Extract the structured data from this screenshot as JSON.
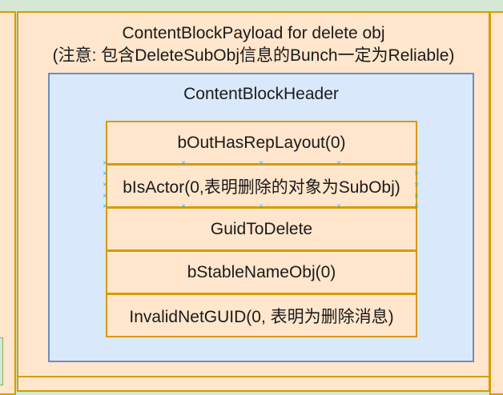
{
  "payload": {
    "title_line1": "ContentBlockPayload for delete obj",
    "title_line2": "(注意: 包含DeleteSubObj信息的Bunch一定为Reliable)"
  },
  "header": {
    "title": "ContentBlockHeader"
  },
  "fields": [
    {
      "label": "bOutHasRepLayout(0)"
    },
    {
      "label": "bIsActor(0,表明删除的对象为SubObj)"
    },
    {
      "label": "GuidToDelete"
    },
    {
      "label": "bStableNameObj(0)"
    },
    {
      "label": "InvalidNetGUID(0, 表明为删除消息)"
    }
  ],
  "colors": {
    "canvas": "#d5e8d4",
    "orange_fill": "#ffe6cc",
    "orange_stroke": "#d79b00",
    "blue_fill": "#dae8fc",
    "blue_stroke": "#6c8ebf",
    "selection_handle": "#29b6f2"
  }
}
